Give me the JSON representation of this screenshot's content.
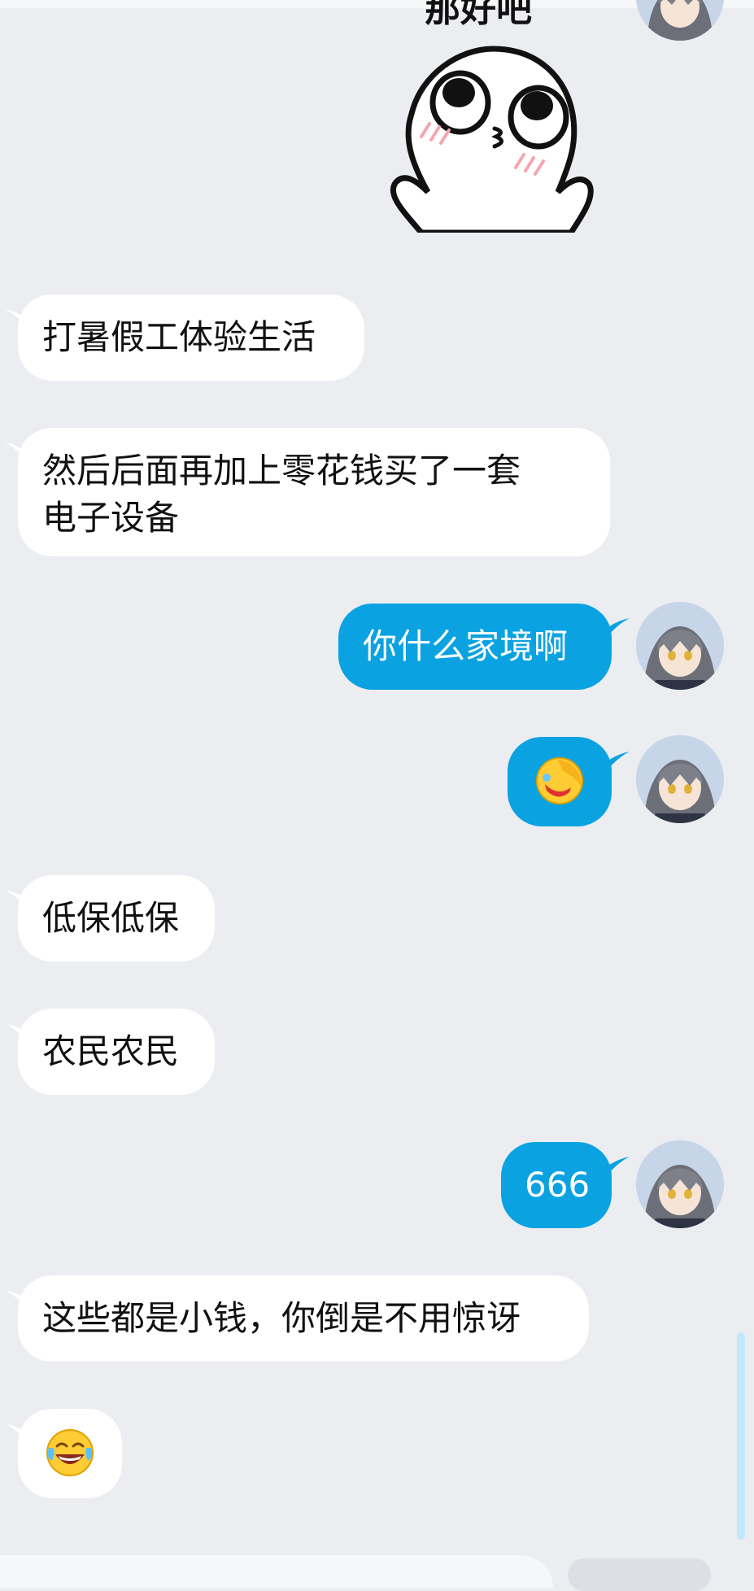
{
  "messages": [
    {
      "side": "right",
      "type": "sticker",
      "text": "那好吧"
    },
    {
      "side": "left",
      "type": "text",
      "lines": [
        "打暑假工体验生活"
      ]
    },
    {
      "side": "left",
      "type": "text",
      "lines": [
        "然后后面再加上零花钱买了一套",
        "电子设备"
      ]
    },
    {
      "side": "right",
      "type": "text",
      "lines": [
        "你什么家境啊"
      ]
    },
    {
      "side": "right",
      "type": "emoji",
      "icon": "facepalm-laugh-emoji"
    },
    {
      "side": "left",
      "type": "text",
      "lines": [
        "低保低保"
      ]
    },
    {
      "side": "left",
      "type": "text",
      "lines": [
        "农民农民"
      ]
    },
    {
      "side": "right",
      "type": "text",
      "lines": [
        "666"
      ]
    },
    {
      "side": "left",
      "type": "text",
      "lines": [
        "这些都是小钱，你倒是不用惊讶"
      ]
    },
    {
      "side": "left",
      "type": "emoji",
      "icon": "tears-of-joy-emoji"
    }
  ],
  "colors": {
    "background": "#ebedf1",
    "bubble_left": "#ffffff",
    "bubble_right": "#0aa2e1",
    "scrollbar": "#bfe9fb"
  }
}
